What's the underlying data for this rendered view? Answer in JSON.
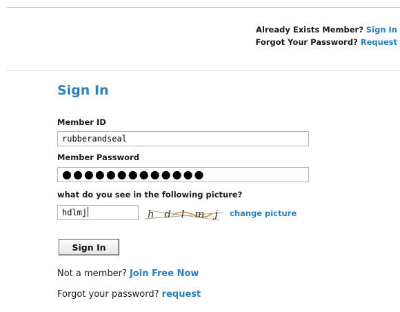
{
  "header": {
    "already_member_text": "Already Exists Member?",
    "sign_in_link": "Sign In",
    "forgot_text": "Forgot Your Password?",
    "request_link": "Request"
  },
  "form": {
    "title": "Sign In",
    "member_id_label": "Member ID",
    "member_id_value": "rubberandseal",
    "password_label": "Member Password",
    "password_mask": "●●●●●●●●●●●●●",
    "captcha_label": "what do you see in the following picture?",
    "captcha_value": "hdlmj",
    "captcha_image_text": "h d l m j",
    "change_picture_link": "change picture",
    "submit_label": "Sign In"
  },
  "footer": {
    "not_member_text": "Not a member?",
    "join_link": "Join Free Now",
    "forgot_text": "Forgot your password?",
    "request_link": "request"
  },
  "colors": {
    "link": "#2a7fb8",
    "title": "#2a82bd",
    "field_border": "#a8b6c8"
  }
}
